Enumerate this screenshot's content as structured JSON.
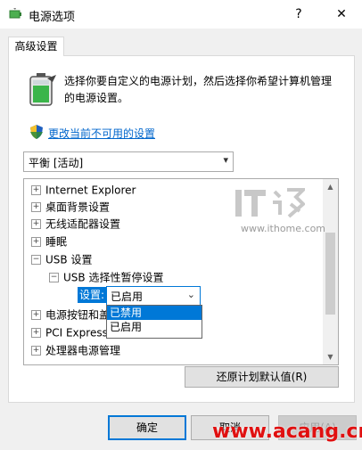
{
  "window": {
    "title": "电源选项",
    "help_label": "?",
    "close_label": "✕"
  },
  "tab": {
    "label": "高级设置"
  },
  "intro_text": "选择你要自定义的电源计划，然后选择你希望计算机管理的电源设置。",
  "unavailable_link": "更改当前不可用的设置",
  "plan_select": {
    "value": "平衡 [活动]"
  },
  "tree": {
    "items": [
      {
        "label": "Internet Explorer",
        "expander": "+"
      },
      {
        "label": "桌面背景设置",
        "expander": "+"
      },
      {
        "label": "无线适配器设置",
        "expander": "+"
      },
      {
        "label": "睡眠",
        "expander": "+"
      },
      {
        "label": "USB 设置",
        "expander": "−"
      },
      {
        "label": "USB 选择性暂停设置",
        "expander": "−"
      },
      {
        "label": "电源按钮和盖",
        "expander": "+"
      },
      {
        "label": "PCI Express",
        "expander": "+"
      },
      {
        "label": "处理器电源管理",
        "expander": "+"
      }
    ],
    "setting_label": "设置:",
    "setting_value": "已启用",
    "dropdown_options": [
      "已禁用",
      "已启用"
    ]
  },
  "restore_button": "还原计划默认值(R)",
  "buttons": {
    "ok": "确定",
    "cancel": "取消",
    "apply": "应用(A)"
  },
  "watermarks": {
    "site": "www.ithome.com",
    "acang": "www.acang.cn"
  },
  "colors": {
    "accent": "#0078d7",
    "link": "#0066cc",
    "watermark_red": "#e01010"
  },
  "icons": {
    "app": "power-options-icon",
    "battery": "battery-icon",
    "shield": "uac-shield-icon"
  }
}
